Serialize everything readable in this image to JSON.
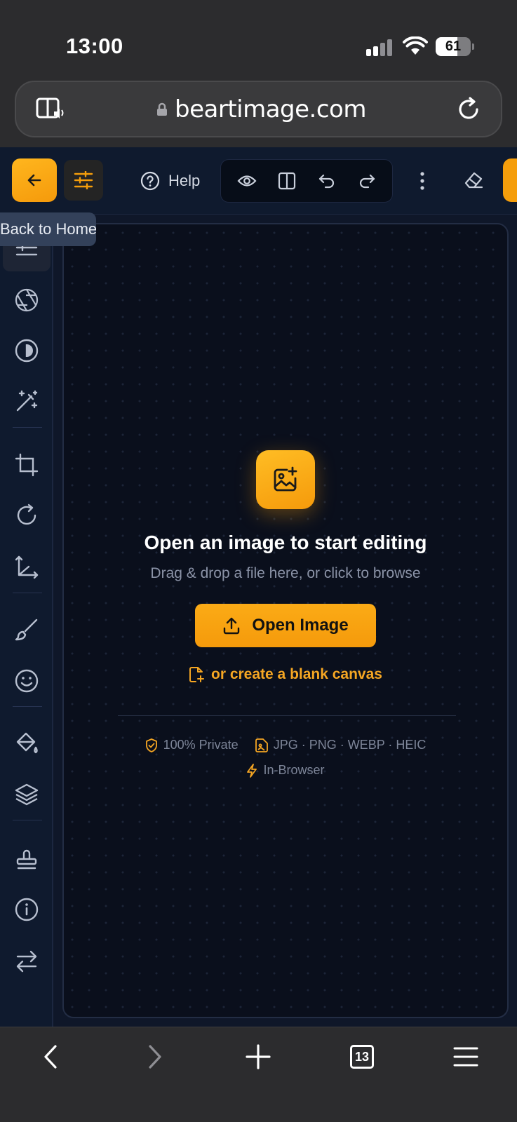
{
  "status_bar": {
    "time": "13:00",
    "battery_level": "61",
    "battery_fraction": 0.61
  },
  "browser": {
    "url": "beartimage.com"
  },
  "toolbar": {
    "help_label": "Help"
  },
  "tooltip": {
    "text": "Back to Home"
  },
  "sidebar": {
    "icons": [
      "adjustments-icon",
      "aperture-icon",
      "contrast-icon",
      "magic-wand-icon",
      "crop-icon",
      "rotate-icon",
      "resize-icon",
      "brush-icon",
      "emoji-icon",
      "paint-bucket-icon",
      "layers-icon",
      "stamp-icon",
      "info-icon",
      "swap-icon"
    ]
  },
  "empty_state": {
    "title": "Open an image to start editing",
    "subtitle": "Drag & drop a file here, or click to browse",
    "open_button": "Open Image",
    "blank_canvas_link": "or create a blank canvas",
    "feature_private": "100% Private",
    "feature_formats": "JPG · PNG · WEBP · HEIC",
    "feature_browser": "In-Browser"
  },
  "browser_bottom": {
    "tab_count": "13"
  },
  "colors": {
    "accent": "#F59E0B",
    "background": "#0F1729",
    "canvas": "#0A0F1C"
  }
}
